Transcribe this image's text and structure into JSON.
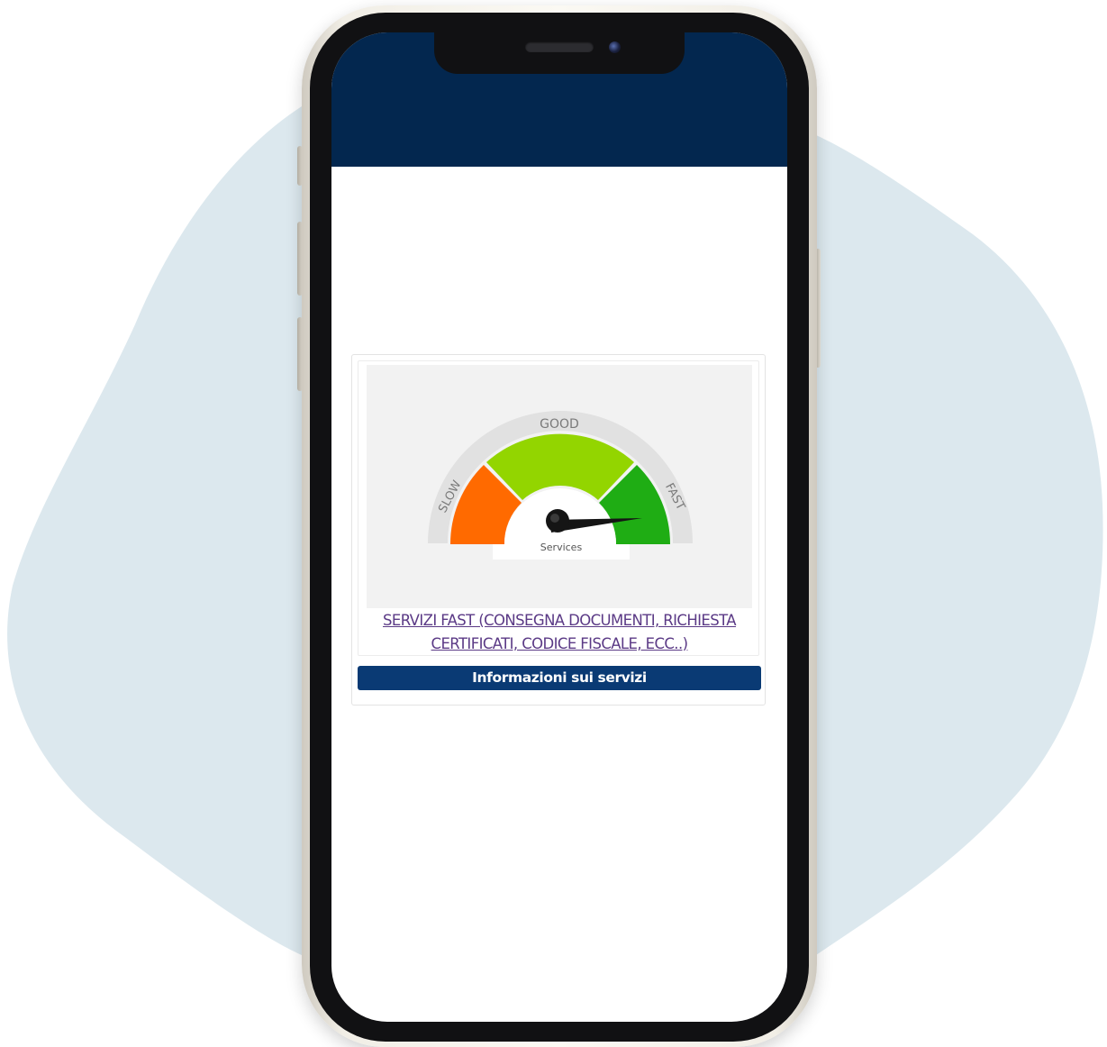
{
  "colors": {
    "blob": "#dce8ee",
    "header": "#03274f",
    "button": "#0a3a74",
    "link": "#5b3a86",
    "gauge_slow": "#ff6a00",
    "gauge_good": "#93d500",
    "gauge_fast": "#1fad14"
  },
  "gauge": {
    "label_slow": "SLOW",
    "label_good": "GOOD",
    "label_fast": "FAST",
    "center_label": "Services",
    "icon": "speedometer-icon"
  },
  "card": {
    "link_text": "SERVIZI FAST (CONSEGNA DOCUMENTI, RICHIESTA CERTIFICATI, CODICE FISCALE, ECC..)",
    "button_label": "Informazioni sui servizi"
  }
}
